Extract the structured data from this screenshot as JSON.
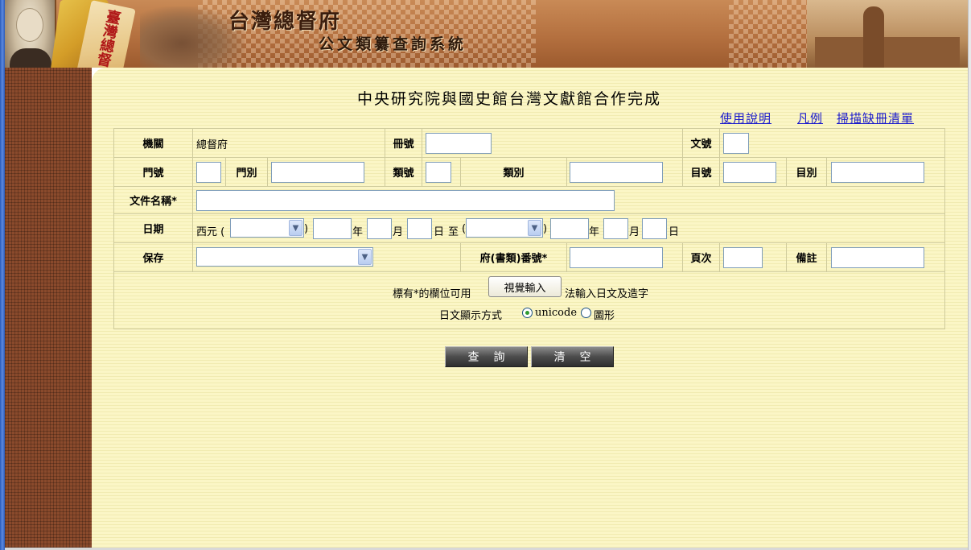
{
  "banner": {
    "title": "台灣總督府",
    "subtitle": "公文類纂查詢系統",
    "scroll_text": "臺灣總督"
  },
  "main": {
    "title": "中央研究院與國史館台灣文獻館合作完成",
    "links": {
      "help": "使用說明",
      "legend": "凡例",
      "missing_list": "掃描缺冊清單"
    }
  },
  "form": {
    "agency_label": "機關",
    "agency_value": "總督府",
    "volume_no_label": "冊號",
    "volume_no_value": "",
    "doc_no_label": "文號",
    "doc_no_value": "",
    "gate_no_label": "門號",
    "gate_no_value": "",
    "gate_label": "門別",
    "gate_value": "",
    "class_no_label": "類號",
    "class_no_value": "",
    "class_label": "類別",
    "class_value": "",
    "item_no_label": "目號",
    "item_no_value": "",
    "item_label": "目別",
    "item_value": "",
    "doc_name_label": "文件名稱*",
    "doc_name_value": "",
    "date_label": "日期",
    "date_prefix": "西元 (",
    "paren_close": ")",
    "year": "年",
    "month": "月",
    "day": "日",
    "to": "至",
    "era_from_selected": "",
    "era_to_selected": "",
    "storage_label": "保存",
    "storage_selected": "",
    "folio_label": "府(書類)番號*",
    "folio_value": "",
    "page_label": "頁次",
    "page_value": "",
    "note_label": "備註",
    "note_value": "",
    "hint_prefix": "標有*的欄位可用",
    "virtual_keyboard_button": "視覺輸入",
    "hint_suffix": "法輸入日文及造字",
    "display_mode_label": "日文顯示方式",
    "display_mode_options": [
      "unicode",
      "圖形"
    ],
    "display_mode_selected": "unicode"
  },
  "actions": {
    "search": "查詢",
    "clear": "清空"
  },
  "colors": {
    "panel_bg": "#fbf6c6",
    "link": "#1a1acc",
    "button_dark": "#4c4c4c",
    "frame_blue": "#2a5ab8"
  }
}
